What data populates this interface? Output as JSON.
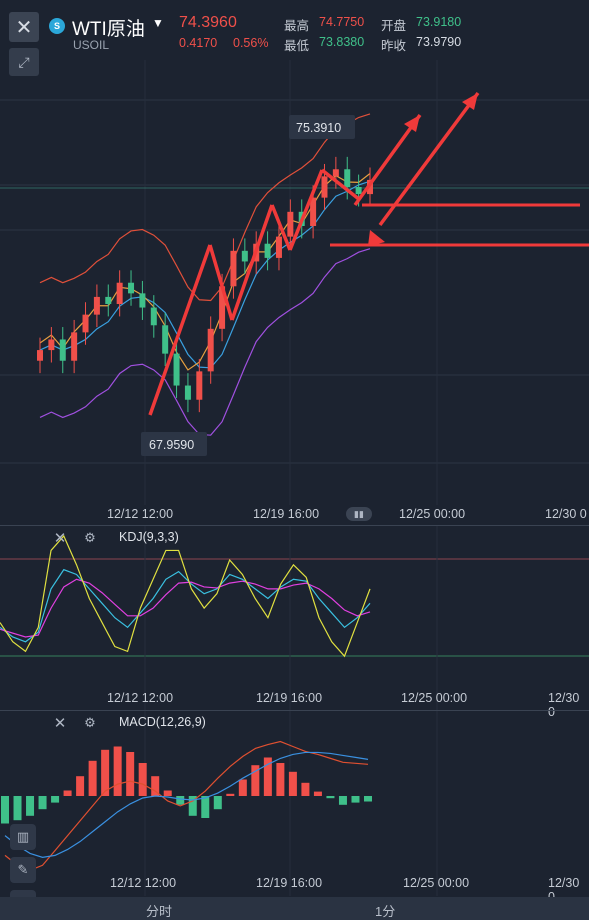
{
  "header": {
    "symbol_name": "WTI原油",
    "symbol_code": "USOIL",
    "price": "74.3960",
    "change": "0.4170",
    "change_pct": "0.56%",
    "high_label": "最高",
    "high_value": "74.7750",
    "low_label": "最低",
    "low_value": "73.8380",
    "open_label": "开盘",
    "open_value": "73.9180",
    "prev_close_label": "昨收",
    "prev_close_value": "73.9790"
  },
  "colors": {
    "up": "#f0504a",
    "down": "#3fc08a",
    "boll_upper": "#e0503a",
    "boll_mid": "#3aa0e0",
    "boll_lower": "#a050e0",
    "ma_short": "#e8a040"
  },
  "x_axis": {
    "labels": [
      "12/12 12:00",
      "12/19 16:00",
      "12/25 00:00",
      "12/30 0"
    ]
  },
  "main": {
    "annotation_high": "75.3910",
    "annotation_low": "67.9590"
  },
  "kdj": {
    "title": "KDJ(9,3,3)"
  },
  "macd": {
    "title": "MACD(12,26,9)"
  },
  "tabs": [
    "分时",
    "1分"
  ],
  "chart_data": [
    {
      "type": "candlestick",
      "title": "WTI原油",
      "x": [
        "12/12 12:00",
        "12/19 16:00",
        "12/25 00:00",
        "12/30 0"
      ],
      "series": [
        {
          "name": "close",
          "values": [
            69.6,
            69.9,
            69.3,
            70.1,
            70.6,
            71.1,
            70.9,
            71.5,
            71.2,
            70.8,
            70.3,
            69.5,
            68.6,
            68.2,
            69.0,
            70.2,
            71.4,
            72.4,
            72.1,
            72.6,
            72.2,
            72.8,
            73.5,
            73.1,
            73.9,
            74.5,
            74.7,
            74.2,
            74.0,
            74.4
          ]
        }
      ],
      "annotations": [
        "75.3910",
        "67.9590"
      ]
    },
    {
      "type": "line",
      "title": "KDJ(9,3,3)",
      "series": [
        {
          "name": "K",
          "values": [
            30,
            20,
            15,
            25,
            70,
            90,
            85,
            70,
            55,
            40,
            30,
            45,
            60,
            80,
            88,
            75,
            65,
            70,
            85,
            80,
            70,
            60,
            72,
            80,
            78,
            60,
            45,
            30,
            40,
            55
          ]
        },
        {
          "name": "D",
          "values": [
            28,
            24,
            20,
            22,
            50,
            72,
            80,
            76,
            66,
            54,
            42,
            42,
            50,
            64,
            76,
            77,
            72,
            71,
            76,
            78,
            75,
            70,
            70,
            74,
            76,
            70,
            60,
            48,
            42,
            46
          ]
        },
        {
          "name": "J",
          "values": [
            35,
            15,
            5,
            30,
            110,
            125,
            95,
            60,
            35,
            10,
            5,
            50,
            80,
            110,
            110,
            70,
            50,
            65,
            100,
            85,
            60,
            40,
            75,
            95,
            82,
            40,
            15,
            0,
            35,
            70
          ]
        }
      ]
    },
    {
      "type": "bar",
      "title": "MACD(12,26,9)",
      "series": [
        {
          "name": "MACD",
          "values": [
            -0.25,
            -0.22,
            -0.18,
            -0.12,
            -0.06,
            0.05,
            0.18,
            0.32,
            0.42,
            0.45,
            0.4,
            0.3,
            0.18,
            0.05,
            -0.08,
            -0.18,
            -0.2,
            -0.12,
            0.02,
            0.15,
            0.28,
            0.35,
            0.3,
            0.22,
            0.12,
            0.04,
            -0.02,
            -0.08,
            -0.06,
            -0.05
          ]
        },
        {
          "name": "DIF",
          "values": [
            -0.6,
            -0.7,
            -0.75,
            -0.7,
            -0.55,
            -0.4,
            -0.25,
            -0.1,
            0.05,
            0.12,
            0.15,
            0.12,
            0.05,
            -0.05,
            -0.1,
            -0.05,
            0.05,
            0.18,
            0.3,
            0.4,
            0.48,
            0.52,
            0.55,
            0.5,
            0.45,
            0.42,
            0.38,
            0.34,
            0.33,
            0.32
          ]
        },
        {
          "name": "DEA",
          "values": [
            -0.4,
            -0.5,
            -0.58,
            -0.62,
            -0.6,
            -0.54,
            -0.46,
            -0.36,
            -0.26,
            -0.16,
            -0.08,
            -0.02,
            0.0,
            -0.01,
            -0.03,
            -0.04,
            -0.02,
            0.03,
            0.1,
            0.18,
            0.25,
            0.32,
            0.38,
            0.42,
            0.44,
            0.44,
            0.43,
            0.41,
            0.39,
            0.37
          ]
        }
      ]
    }
  ]
}
